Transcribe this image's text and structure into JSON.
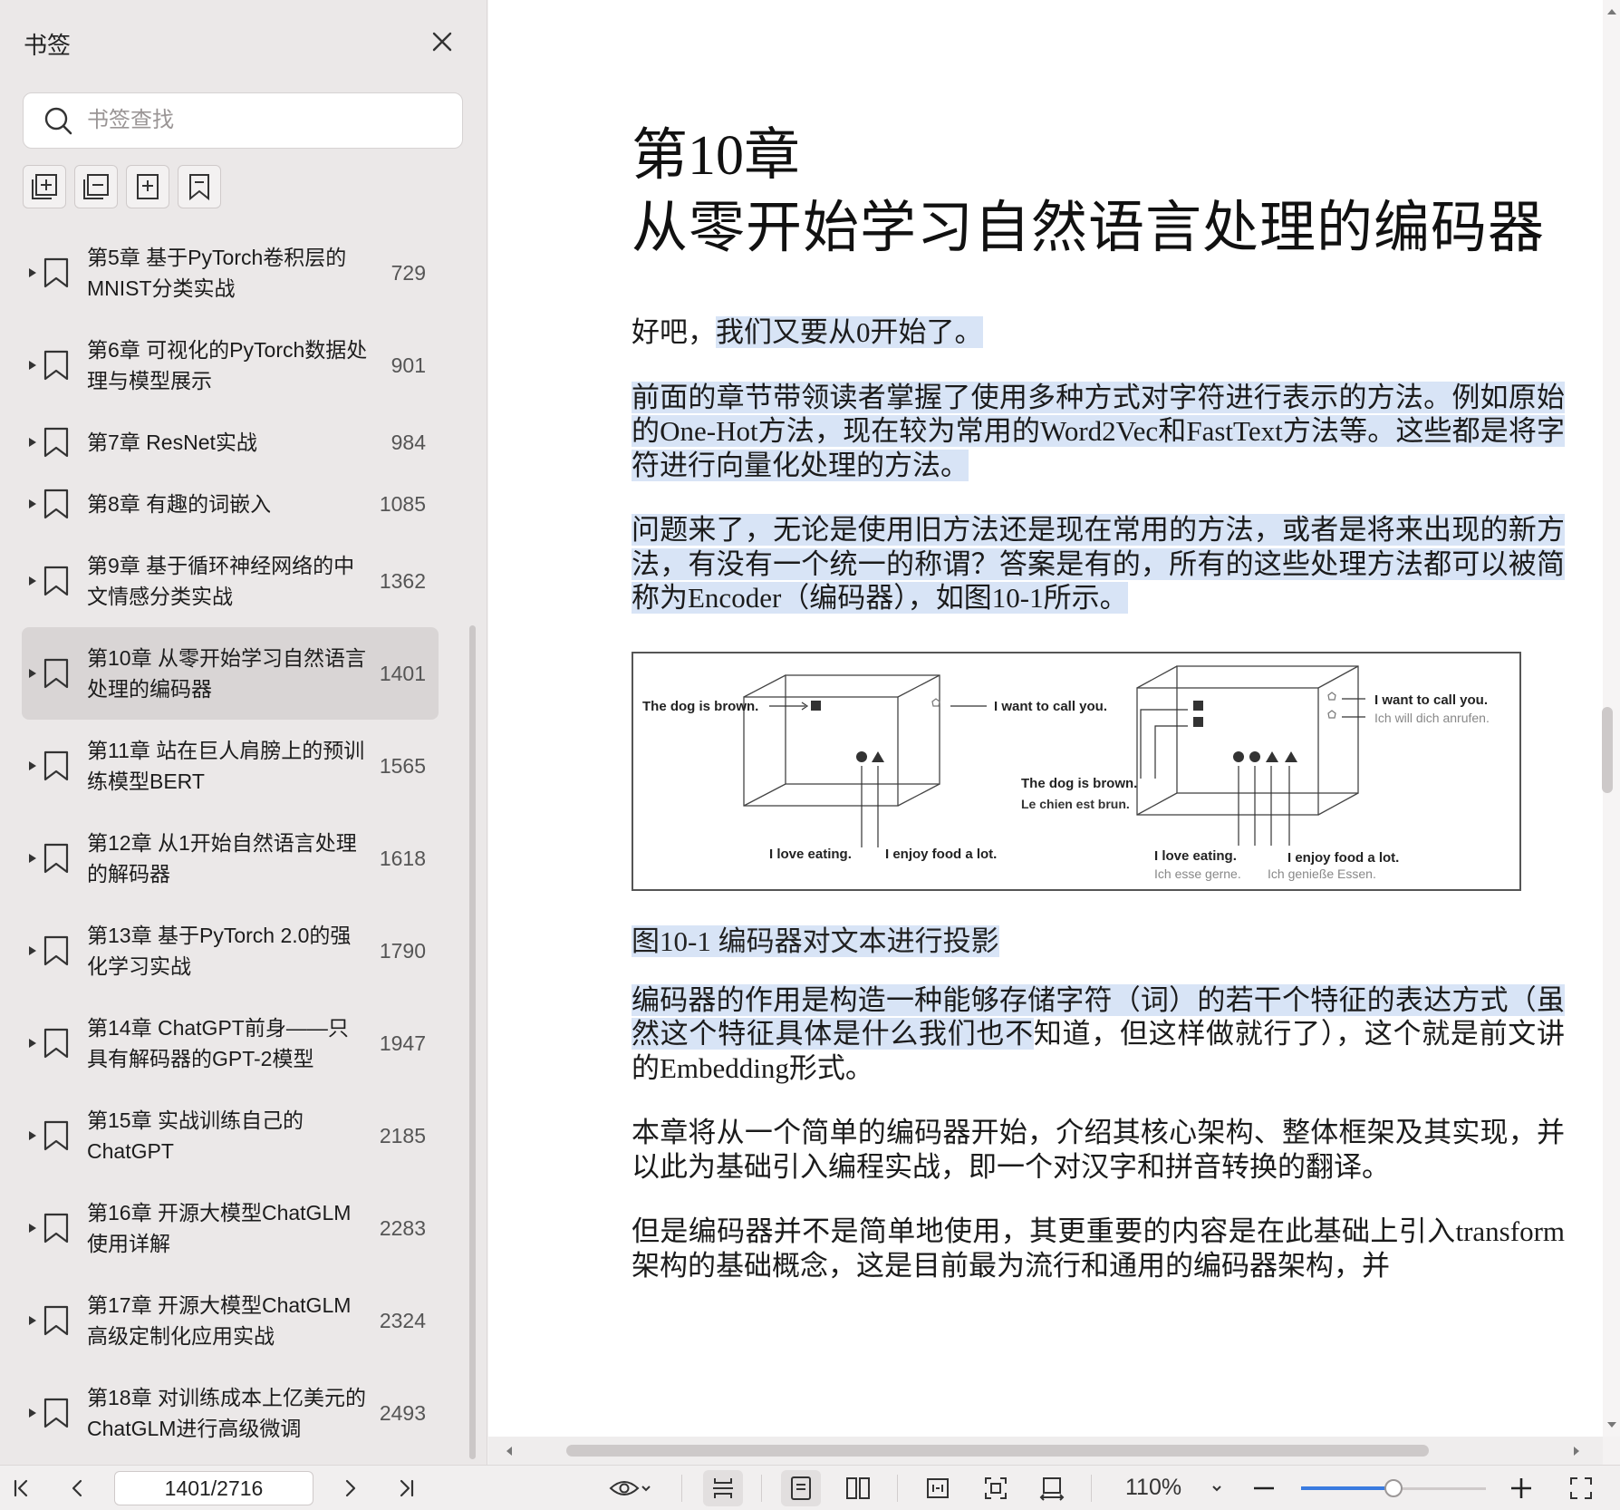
{
  "sidebar": {
    "title": "书签",
    "search_placeholder": "书签查找",
    "bookmarks": [
      {
        "label": "第5章 基于PyTorch卷积层的MNIST分类实战",
        "page": "729"
      },
      {
        "label": "第6章 可视化的PyTorch数据处理与模型展示",
        "page": "901"
      },
      {
        "label": "第7章 ResNet实战",
        "page": "984"
      },
      {
        "label": "第8章 有趣的词嵌入",
        "page": "1085"
      },
      {
        "label": "第9章 基于循环神经网络的中文情感分类实战",
        "page": "1362"
      },
      {
        "label": "第10章 从零开始学习自然语言处理的编码器",
        "page": "1401"
      },
      {
        "label": "第11章 站在巨人肩膀上的预训练模型BERT",
        "page": "1565"
      },
      {
        "label": "第12章 从1开始自然语言处理的解码器",
        "page": "1618"
      },
      {
        "label": "第13章 基于PyTorch 2.0的强化学习实战",
        "page": "1790"
      },
      {
        "label": "第14章 ChatGPT前身——只具有解码器的GPT-2模型",
        "page": "1947"
      },
      {
        "label": "第15章 实战训练自己的ChatGPT",
        "page": "2185"
      },
      {
        "label": "第16章 开源大模型ChatGLM使用详解",
        "page": "2283"
      },
      {
        "label": "第17章 开源大模型ChatGLM高级定制化应用实战",
        "page": "2324"
      },
      {
        "label": "第18章 对训练成本上亿美元的ChatGLM进行高级微调",
        "page": "2493"
      }
    ]
  },
  "document": {
    "chapter_number": "第10章",
    "chapter_title": "从零开始学习自然语言处理的编码器",
    "p1_plain": "好吧，",
    "p1_hl": "我们又要从0开始了。",
    "p2": "前面的章节带领读者掌握了使用多种方式对字符进行表示的方法。例如原始的One-Hot方法，现在较为常用的Word2Vec和FastText方法等。这些都是将字符进行向量化处理的方法。",
    "p3": "问题来了，无论是使用旧方法还是现在常用的方法，或者是将来出现的新方法，有没有一个统一的称谓？答案是有的，所有的这些处理方法都可以被简称为Encoder（编码器），如图10-1所示。",
    "figure": {
      "left": {
        "t1": "The dog is brown.",
        "t2": "I want to call you.",
        "t3": "I love eating.",
        "t4": "I enjoy food a lot."
      },
      "right": {
        "t1": "I want to call you.",
        "t2": "Ich will dich anrufen.",
        "t3": "The dog is brown.",
        "t4": "Le chien est brun.",
        "t5": "I love eating.",
        "t6": "Ich esse gerne.",
        "t7": "I enjoy food a lot.",
        "t8": "Ich genieße Essen."
      }
    },
    "caption": "图10-1 编码器对文本进行投影",
    "p4_hl": "编码器的作用是构造一种能够存储字符（词）的若干个特征的表达方式（虽然这个特征具体是什么我们也不",
    "p4_plain": "知道，但这样做就行了），这个就是前文讲的Embedding形式。",
    "p5": "本章将从一个简单的编码器开始，介绍其核心架构、整体框架及其实现，并以此为基础引入编程实战，即一个对汉字和拼音转换的翻译。",
    "p6": "但是编码器并不是简单地使用，其更重要的内容是在此基础上引入transform架构的基础概念，这是目前最为流行和通用的编码器架构，并"
  },
  "toolbar": {
    "page_indicator": "1401/2716",
    "zoom": "110%",
    "zoom_level_fraction": 0.5
  },
  "colors": {
    "highlight": "#d8e4f6",
    "slider_fill": "#3a7be0",
    "sidebar_bg": "#ebe8e8",
    "active_item_bg": "#d9d5d5"
  }
}
